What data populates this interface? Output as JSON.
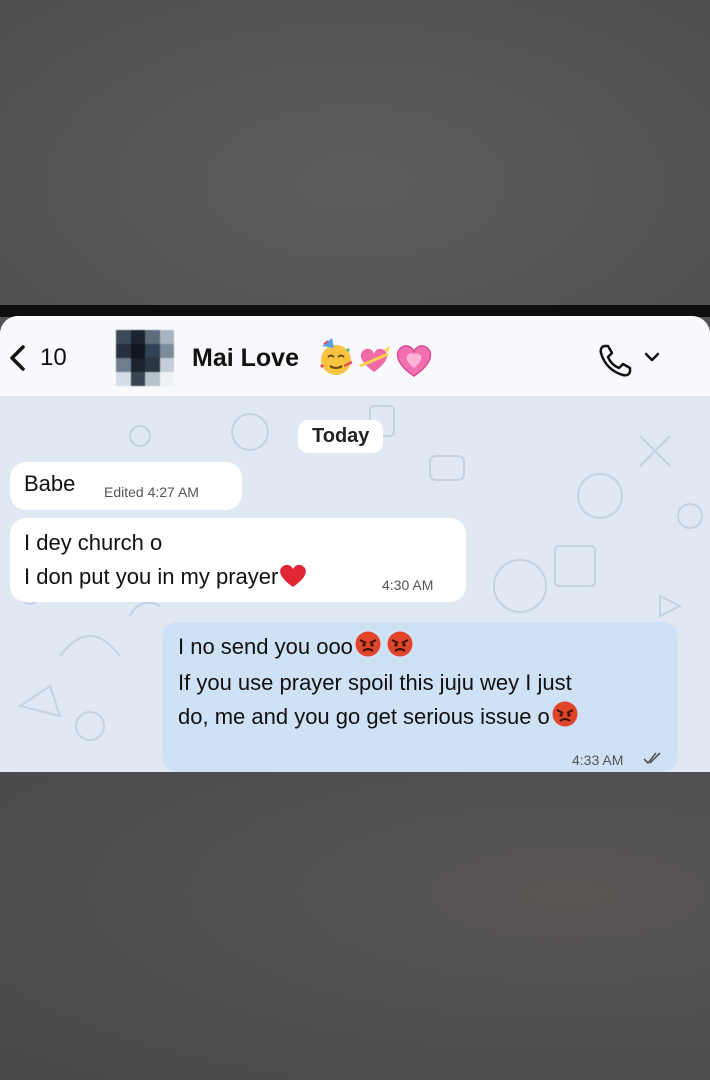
{
  "header": {
    "back_count": "10",
    "contact_name": "Mai Love",
    "contact_emojis": [
      "partying-face",
      "heart-with-ribbon",
      "growing-heart"
    ]
  },
  "chat": {
    "date_label": "Today",
    "messages": [
      {
        "direction": "incoming",
        "lines": [
          "Babe"
        ],
        "meta": "Edited 4:27 AM"
      },
      {
        "direction": "incoming",
        "lines": [
          "I dey church o",
          "I don put you in my prayer"
        ],
        "trailing_emoji": "red-heart",
        "meta": "4:30 AM"
      },
      {
        "direction": "outgoing",
        "lines": [
          "I no send you ooo",
          "If you use prayer spoil this juju wey I just",
          "do, me and you go get serious issue o"
        ],
        "emojis": [
          "angry-face",
          "angry-face",
          "angry-face"
        ],
        "meta": "4:33 AM",
        "status": "read-double-check"
      }
    ]
  },
  "colors": {
    "outgoing_bubble": "#cfe1f5",
    "incoming_bubble": "#ffffff",
    "chat_background": "#dfe8f3",
    "angry_emoji": "#e0452a",
    "heart": "#e32636"
  }
}
